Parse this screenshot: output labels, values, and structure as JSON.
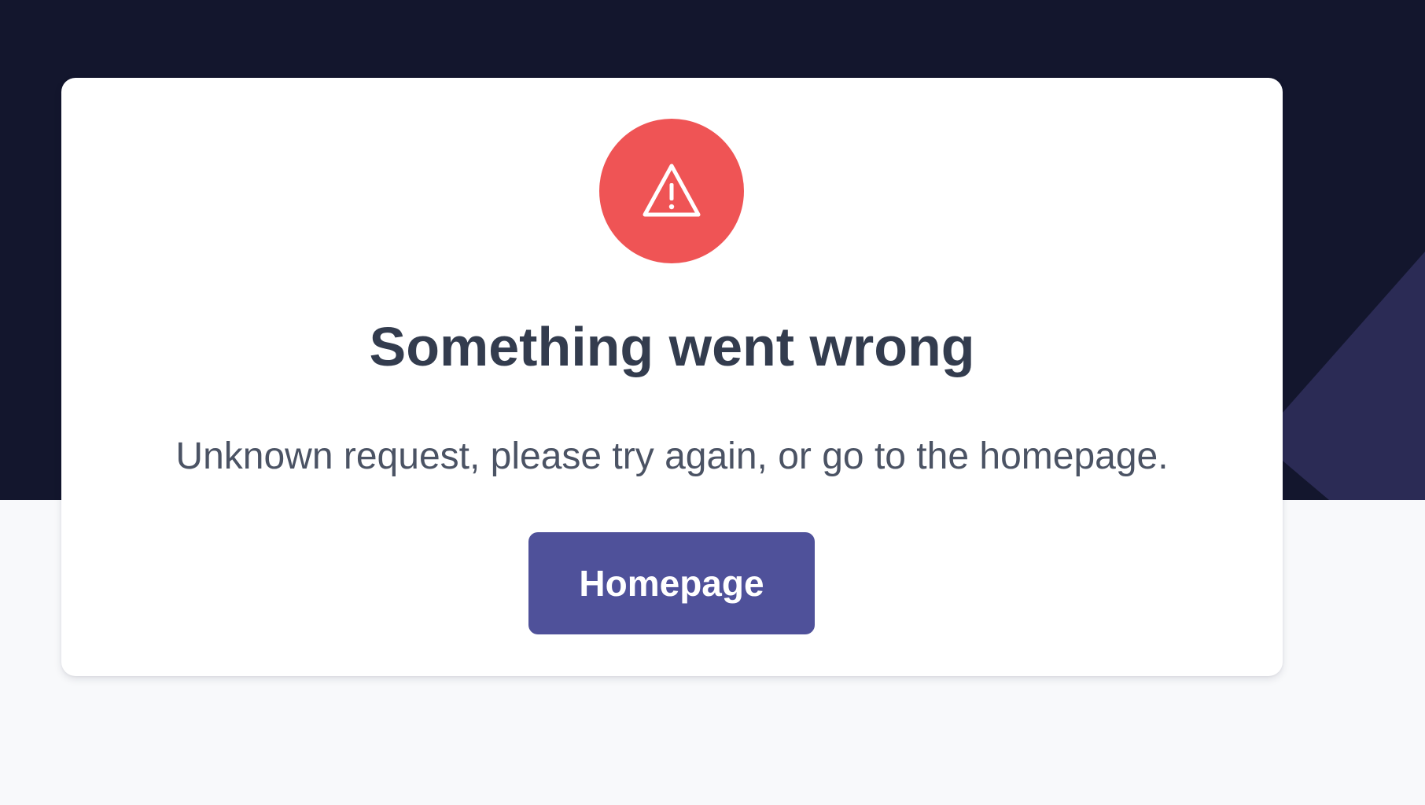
{
  "page": {
    "background_color": "#f8f9fb",
    "hero_color": "#13162d",
    "hero_accent_color": "#2b2b55"
  },
  "error": {
    "icon": "warning-triangle-icon",
    "icon_bg_color": "#ef5455",
    "title": "Something went wrong",
    "message": "Unknown request, please try again, or go to the homepage.",
    "button_label": "Homepage",
    "button_color": "#4f519a"
  }
}
